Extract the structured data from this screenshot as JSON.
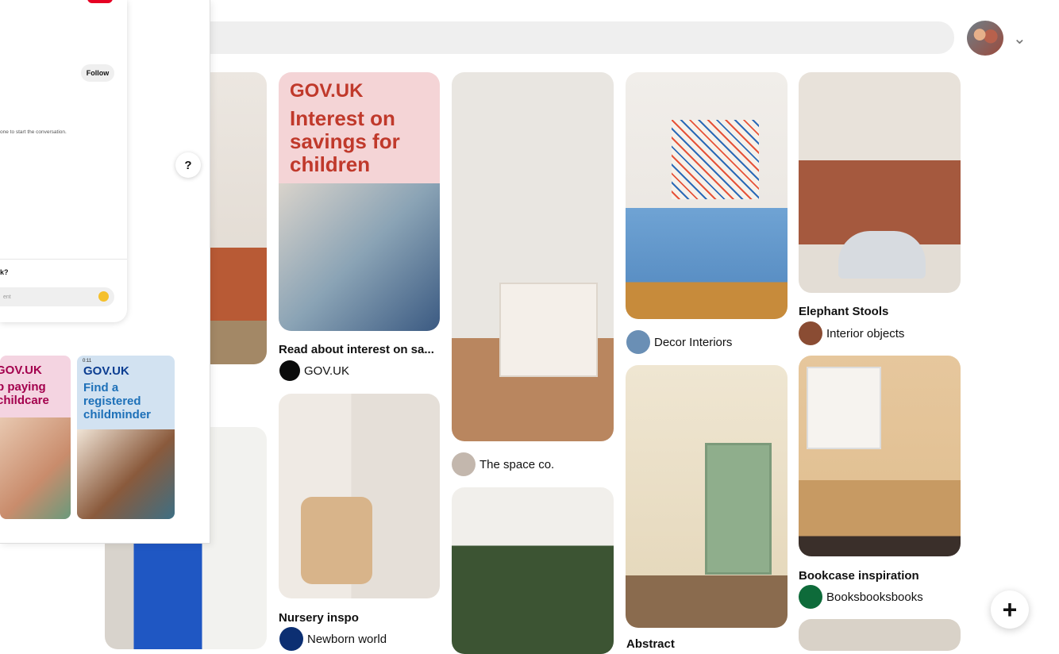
{
  "header": {
    "search_placeholder": "",
    "avatar_label": ""
  },
  "pins": [
    {
      "title": "",
      "source": "The space co."
    },
    {
      "title": "Read about interest on sa...",
      "source": "GOV.UK"
    },
    {
      "title": "Nursery inspo",
      "source": "Newborn world"
    },
    {
      "title": "",
      "source": "Decor Interiors"
    },
    {
      "title": "Elephant Stools",
      "source": "Interior objects"
    },
    {
      "title": "Bookcase inspiration",
      "source": "Booksbooksbooks"
    },
    {
      "title": "Abstract",
      "source": ""
    }
  ],
  "gov_ad": {
    "brand": "GOV.UK",
    "headline": "Interest on savings for children"
  },
  "panel": {
    "follow_label": "Follow",
    "conversation_text": "one to start the conversation.",
    "question_text": "k?",
    "comment_placeholder": "ent",
    "help_label": "?",
    "ads": [
      {
        "brand": "GOV.UK",
        "text": "p paying childcare"
      },
      {
        "brand": "GOV.UK",
        "badge": "0:11",
        "text": "Find a registered childminder"
      }
    ]
  },
  "fab_label": "+",
  "colors": {
    "brand_red": "#e60023",
    "gov_pink": "#f4d4d6",
    "gov_blue": "#d2e2f1",
    "gov_text_red": "#c0392b"
  }
}
